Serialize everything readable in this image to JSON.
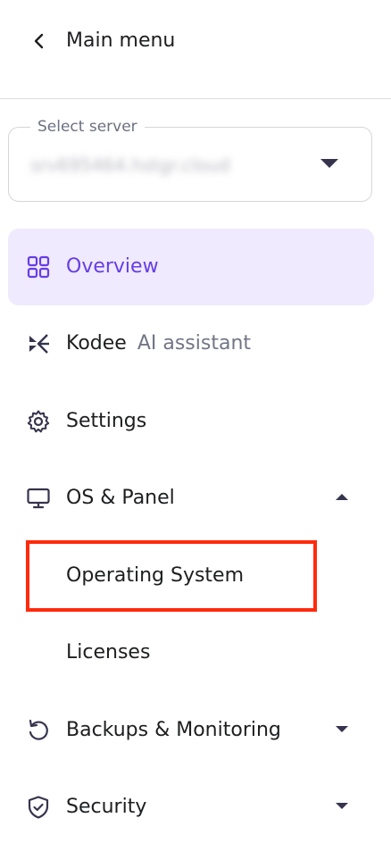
{
  "header": {
    "back_label": "Main menu"
  },
  "server_select": {
    "legend": "Select server",
    "value": "srv695464.hstgr.cloud"
  },
  "nav": {
    "overview": {
      "label": "Overview",
      "icon": "dashboard-grid-icon",
      "active": true
    },
    "kodee": {
      "label": "Kodee",
      "sublabel": "AI assistant",
      "icon": "kodee-sparkle-icon"
    },
    "settings": {
      "label": "Settings",
      "icon": "gear-icon"
    },
    "os_panel": {
      "label": "OS & Panel",
      "icon": "monitor-icon",
      "expanded": true,
      "children": [
        {
          "label": "Operating System",
          "highlighted": true
        },
        {
          "label": "Licenses"
        }
      ]
    },
    "backups": {
      "label": "Backups & Monitoring",
      "icon": "restore-icon"
    },
    "security": {
      "label": "Security",
      "icon": "shield-check-icon"
    }
  },
  "colors": {
    "accent": "#673de6",
    "active_bg": "#efeafd",
    "highlight": "#ff2a0d",
    "text": "#1d1e20",
    "muted": "#727586"
  }
}
